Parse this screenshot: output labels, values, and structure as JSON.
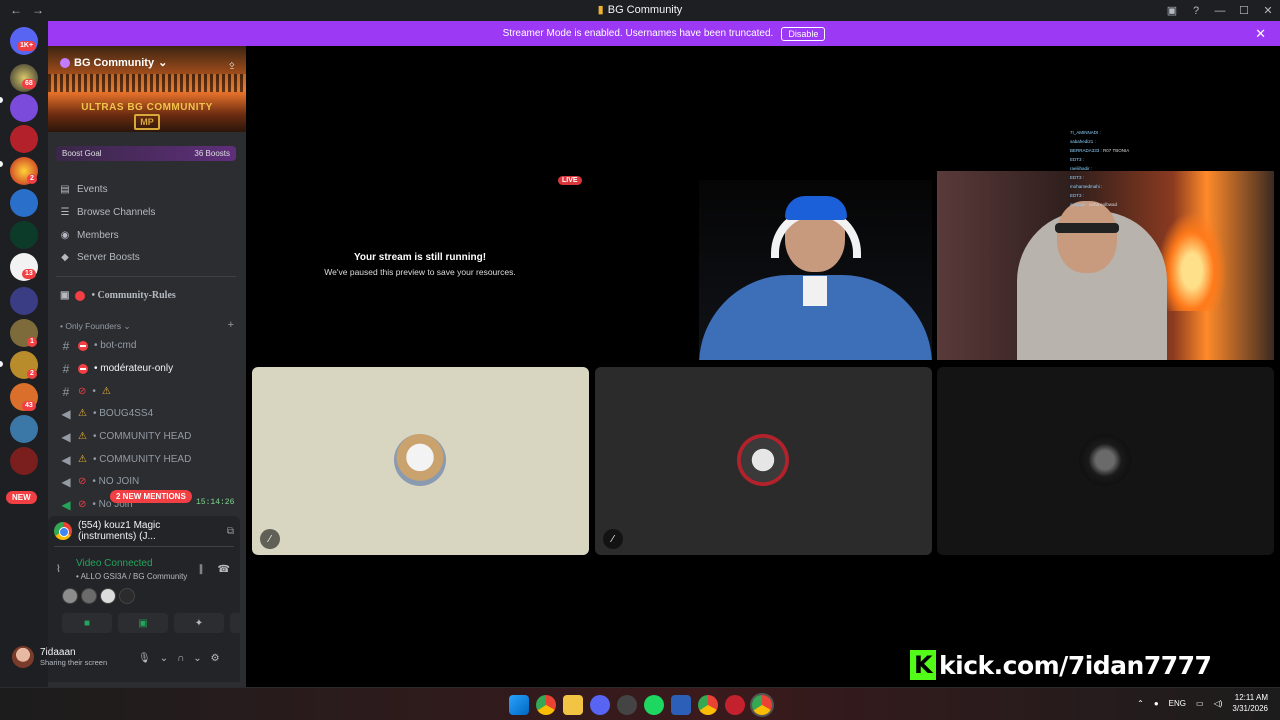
{
  "window": {
    "title": "BG Community",
    "nav_back": "←",
    "nav_forward": "→"
  },
  "streamer_bar": {
    "message": "Streamer Mode is enabled. Usernames have been truncated.",
    "button": "Disable"
  },
  "guilds": {
    "badges": [
      "1K+",
      "68",
      "2",
      "13",
      "1",
      "2",
      "43"
    ],
    "new_label": "NEW"
  },
  "server": {
    "name": "BG Community",
    "banner_title": "ULTRAS BG COMMUNITY",
    "banner_logo": "MP",
    "boost_goal": "Boost Goal",
    "boost_count": "36 Boosts",
    "menu": [
      "Events",
      "Browse Channels",
      "Members",
      "Server Boosts"
    ],
    "rules_channel": "• Community-Rules",
    "category": "• Only Founders",
    "channels": [
      {
        "name": "• bot-cmd",
        "kind": "text",
        "mark": "noentry"
      },
      {
        "name": "• modérateur-only",
        "kind": "text",
        "mark": "noentry"
      },
      {
        "name": "•",
        "kind": "text",
        "mark": "blocked"
      },
      {
        "name": "• BOUG4SS4",
        "kind": "voice",
        "mark": "warn"
      },
      {
        "name": "• COMMUNITY HEAD",
        "kind": "voice",
        "mark": "warn"
      },
      {
        "name": "• COMMUNITY HEAD",
        "kind": "voice",
        "mark": "warn"
      },
      {
        "name": "• NO JOIN",
        "kind": "voice",
        "mark": "blocked"
      },
      {
        "name": "• No Join",
        "kind": "voice",
        "mark": "blocked"
      }
    ],
    "mentions_label": "2 NEW MENTIONS",
    "overlay_time": "15:14:26"
  },
  "activity": {
    "title": "(554) kouz1 Magic (instruments) (J...",
    "status": "Video Connected",
    "channel": "• ALLO GSI3A / BG Community"
  },
  "user": {
    "name": "7idaaan",
    "status": "Sharing their screen"
  },
  "stage": {
    "live_badge": "LIVE",
    "paused_title": "Your stream is still running!",
    "paused_sub": "We've paused this preview to save your resources.",
    "chat_lines": [
      {
        "user": "7I_AMINNADI :",
        "msg": ""
      },
      {
        "user": "sabahedi21 :",
        "msg": ""
      },
      {
        "user": "BERRADA333 :",
        "msg": "R07 TBONIA"
      },
      {
        "user": "EDT3 :",
        "msg": ""
      },
      {
        "user": "raeliihadir :",
        "msg": ""
      },
      {
        "user": "EDT3 :",
        "msg": ""
      },
      {
        "user": "mohamedmahi :",
        "msg": ""
      },
      {
        "user": "EDT3 :",
        "msg": ""
      },
      {
        "user": "ayoyuin :",
        "msg": "echa eolbwad"
      }
    ],
    "kick_text": "kick.com/7idan7777"
  },
  "taskbar": {
    "lang": "ENG",
    "time": "12:11 AM",
    "date": "3/31/2026"
  }
}
